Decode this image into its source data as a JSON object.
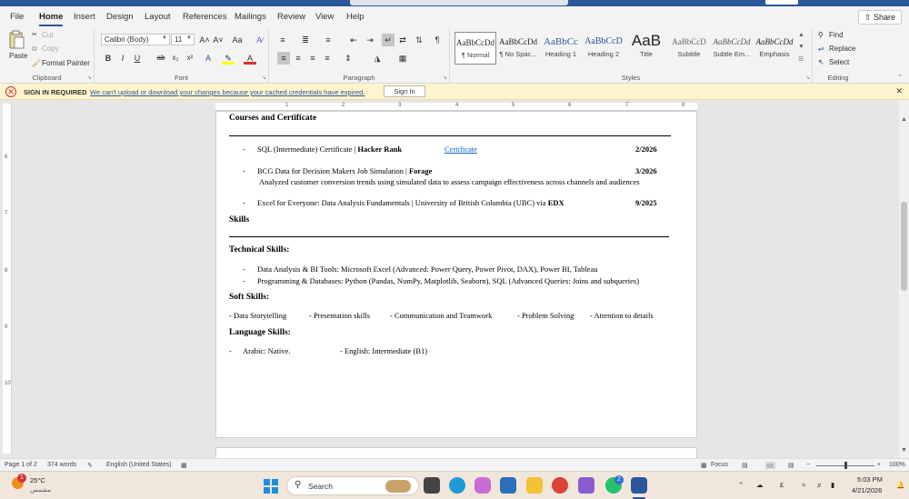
{
  "tabs": [
    "File",
    "Home",
    "Insert",
    "Design",
    "Layout",
    "References",
    "Mailings",
    "Review",
    "View",
    "Help"
  ],
  "share_label": "Share",
  "ribbon": {
    "clipboard": {
      "paste": "Paste",
      "cut": "Cut",
      "copy": "Copy",
      "format_painter": "Format Painter",
      "label": "Clipboard"
    },
    "font": {
      "family": "Calibri (Body)",
      "size": "11",
      "grow": "A˄",
      "shrink": "A˅",
      "change_case": "Aa",
      "bold": "B",
      "italic": "I",
      "underline": "U",
      "strike": "ab",
      "subscript": "x₂",
      "superscript": "x²",
      "label": "Font"
    },
    "paragraph": {
      "label": "Paragraph",
      "show_marks": "¶"
    },
    "styles": {
      "label": "Styles",
      "items": [
        {
          "preview": "AaBbCcDd",
          "name": "¶ Normal"
        },
        {
          "preview": "AaBbCcDd",
          "name": "¶ No Spac..."
        },
        {
          "preview": "AaBbCc",
          "name": "Heading 1"
        },
        {
          "preview": "AaBbCcD",
          "name": "Heading 2"
        },
        {
          "preview": "AaB",
          "name": "Title"
        },
        {
          "preview": "AaBbCcD",
          "name": "Subtitle"
        },
        {
          "preview": "AaBbCcDd",
          "name": "Subtle Em..."
        },
        {
          "preview": "AaBbCcDd",
          "name": "Emphasis"
        }
      ]
    },
    "editing": {
      "find": "Find",
      "replace": "Replace",
      "select": "Select",
      "label": "Editing"
    }
  },
  "notification": {
    "title": "SIGN IN REQUIRED",
    "message": "We can't upload or download your changes because your cached credentials have expired.",
    "button": "Sign In"
  },
  "document": {
    "courses_heading": "Courses and Certificate",
    "courses": [
      {
        "bullet": "-",
        "text": "SQL (Intermediate) Certificate | ",
        "org": "Hacker Rank",
        "link": "Certificate",
        "date": "2/2026"
      },
      {
        "bullet": "-",
        "text": "BCG Data for Decision Makers Job Simulation | ",
        "org": "Forage",
        "date": "3/2026",
        "desc": "Analyzed customer conversion trends using simulated data to assess campaign effectiveness across channels and audiences"
      },
      {
        "bullet": "-",
        "text": "Excel for Everyone: Data Analysis Fundamentals | University of British Columbia (UBC) via ",
        "org": "EDX",
        "date": "9/2025"
      }
    ],
    "skills_heading": "Skills",
    "technical_heading": "Technical Skills:",
    "technical": [
      "Data Analysis & BI Tools: Microsoft Excel (Advanced: Power Query, Power Pivot, DAX), Power BI, Tableau",
      "Programming & Databases: Python (Pandas, NumPy, Matplotlib, Seaborn), SQL (Advanced Queries: Joins and subqueries)"
    ],
    "soft_heading": "Soft Skills:",
    "soft": [
      "- Data Storytelling",
      "- Presentation skills",
      "- Communication and Teamwork",
      "- Problem Solving",
      "- Attention to details"
    ],
    "language_heading": "Language Skills:",
    "languages": [
      "Arabic: Native.",
      "- English: Intermediate (B1)"
    ],
    "language_bullet": "-"
  },
  "ruler": {
    "h_marks": [
      "1",
      "2",
      "3",
      "4",
      "5",
      "6",
      "7",
      "8"
    ],
    "v_marks": [
      "6",
      "7",
      "8",
      "9",
      "10"
    ]
  },
  "status": {
    "page": "Page 1 of 2",
    "words": "374 words",
    "language": "English (United States)",
    "focus": "Focus",
    "zoom_value": "100%",
    "zoom_minus": "−",
    "zoom_plus": "+"
  },
  "taskbar": {
    "temperature": "25°C",
    "weather": "مشمس",
    "notif_count": "1",
    "search": "Search",
    "whatsapp_count": "2",
    "time": "5:03 PM",
    "date": "4/21/2026",
    "lang": "£"
  }
}
